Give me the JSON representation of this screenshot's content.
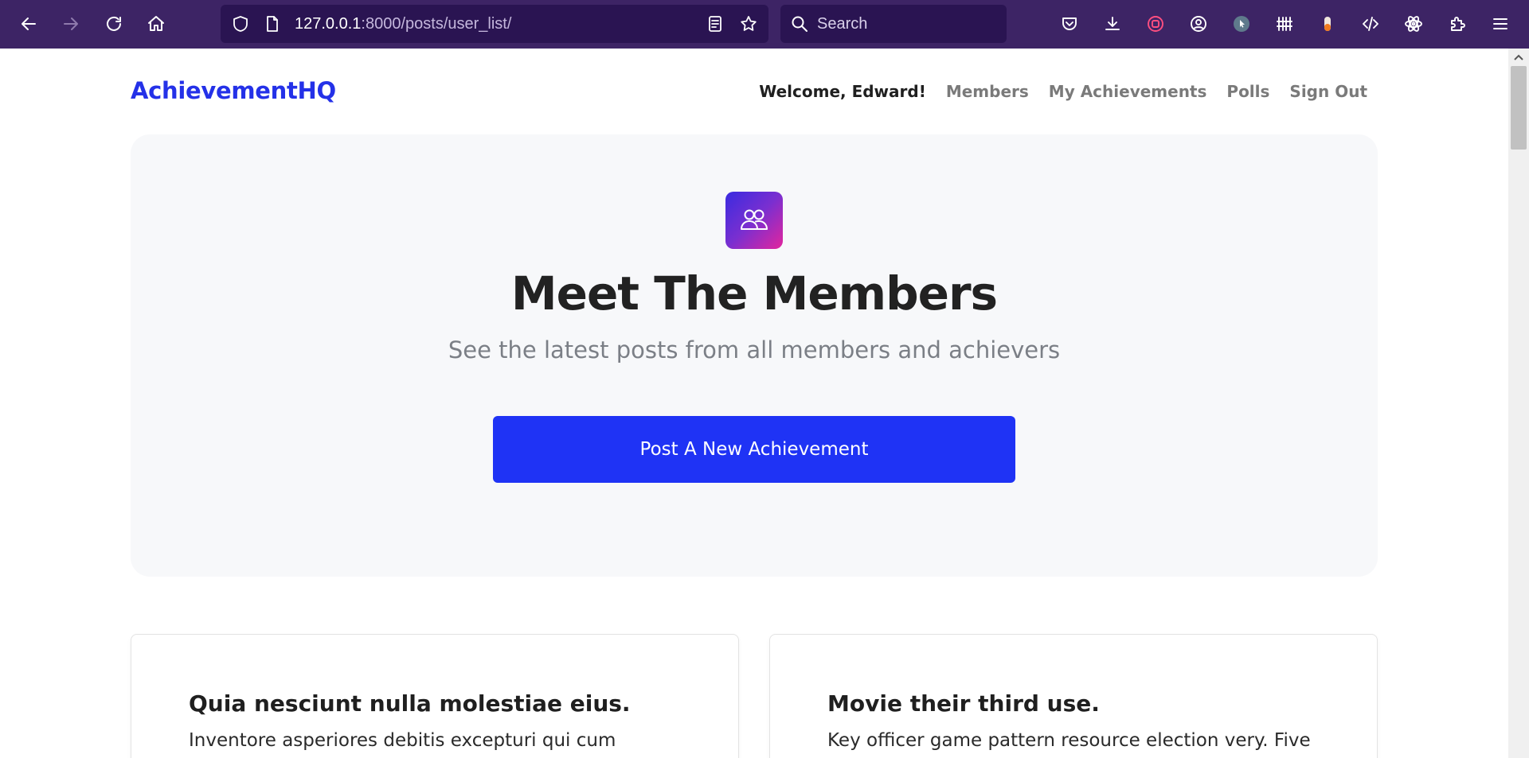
{
  "browser": {
    "url_host": "127.0.0.1",
    "url_path": ":8000/posts/user_list/",
    "search_placeholder": "Search"
  },
  "site": {
    "brand": "AchievementHQ",
    "nav": {
      "welcome": "Welcome, Edward!",
      "members": "Members",
      "my_achievements": "My Achievements",
      "polls": "Polls",
      "sign_out": "Sign Out"
    }
  },
  "hero": {
    "icon": "users-icon",
    "title": "Meet The Members",
    "subtitle": "See the latest posts from all members and achievers",
    "cta_label": "Post A New Achievement"
  },
  "posts": [
    {
      "title": "Quia nesciunt nulla molestiae eius.",
      "body": "Inventore asperiores debitis excepturi qui cum"
    },
    {
      "title": "Movie their third use.",
      "body": "Key officer game pattern resource election very. Five"
    }
  ],
  "colors": {
    "browser_chrome": "#3d2465",
    "brand": "#2431e8",
    "cta": "#1f33f5",
    "hero_bg": "#f7f8fa"
  }
}
